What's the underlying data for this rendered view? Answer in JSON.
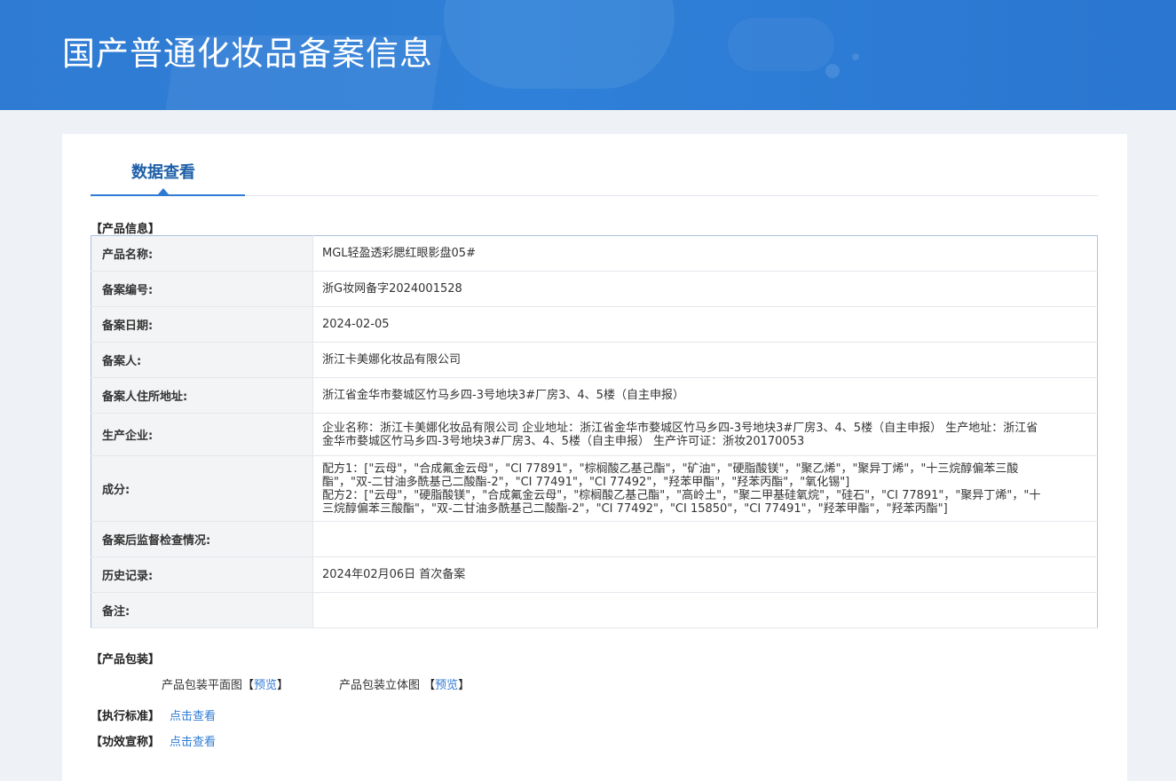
{
  "header": {
    "title": "国产普通化妆品备案信息"
  },
  "tabs": [
    {
      "label": "数据查看"
    }
  ],
  "product_info": {
    "section_title": "【产品信息】",
    "rows": [
      {
        "label": "产品名称:",
        "value": "MGL轻盈透彩腮红眼影盘05#"
      },
      {
        "label": "备案编号:",
        "value": "浙G妆网备字2024001528"
      },
      {
        "label": "备案日期:",
        "value": "2024-02-05"
      },
      {
        "label": "备案人:",
        "value": "浙江卡美娜化妆品有限公司"
      },
      {
        "label": "备案人住所地址:",
        "value": "浙江省金华市婺城区竹马乡四-3号地块3#厂房3、4、5楼（自主申报）"
      },
      {
        "label": "生产企业:",
        "value": "企业名称：浙江卡美娜化妆品有限公司 企业地址：浙江省金华市婺城区竹马乡四-3号地块3#厂房3、4、5楼（自主申报） 生产地址：浙江省金华市婺城区竹马乡四-3号地块3#厂房3、4、5楼（自主申报） 生产许可证：浙妆20170053"
      },
      {
        "label": "成分:",
        "value_lines": [
          "配方1：[\"云母\"，\"合成氟金云母\"，\"CI 77891\"，\"棕榈酸乙基己酯\"，\"矿油\"，\"硬脂酸镁\"，\"聚乙烯\"，\"聚异丁烯\"，\"十三烷醇偏苯三酸酯\"，\"双-二甘油多酰基己二酸酯-2\"，\"CI 77491\"，\"CI 77492\"，\"羟苯甲酯\"，\"羟苯丙酯\"，\"氧化锡\"]",
          "配方2：[\"云母\"，\"硬脂酸镁\"，\"合成氟金云母\"，\"棕榈酸乙基己酯\"，\"高岭土\"，\"聚二甲基硅氧烷\"，\"硅石\"，\"CI 77891\"，\"聚异丁烯\"，\"十三烷醇偏苯三酸酯\"，\"双-二甘油多酰基己二酸酯-2\"，\"CI 77492\"，\"CI 15850\"，\"CI 77491\"，\"羟苯甲酯\"，\"羟苯丙酯\"]"
        ]
      },
      {
        "label": "备案后监督检查情况:",
        "value": ""
      },
      {
        "label": "历史记录:",
        "value": "2024年02月06日 首次备案"
      },
      {
        "label": "备注:",
        "value": ""
      }
    ]
  },
  "packaging": {
    "section_title": "【产品包装】",
    "flat_label": "产品包装平面图",
    "solid_label": "产品包装立体图",
    "preview_label": "预览",
    "bracket_open": "【",
    "bracket_close": "】"
  },
  "standard": {
    "section_title": "【执行标准】",
    "link": "点击查看"
  },
  "efficacy": {
    "section_title": "【功效宣称】",
    "link": "点击查看"
  },
  "colors": {
    "banner": "#2f7bd3",
    "accent": "#1d5fa8",
    "link": "#2f7bd3"
  }
}
